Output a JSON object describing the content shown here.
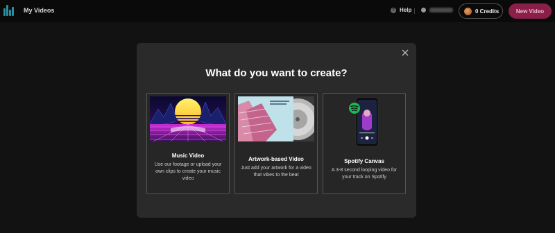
{
  "header": {
    "title": "My Videos",
    "help_label": "Help",
    "credits_label": "0 Credits",
    "new_video_label": "New Video"
  },
  "modal": {
    "title": "What do you want to create?",
    "options": [
      {
        "label": "Music Video",
        "description": "Use our footage or upload your own clips to create your music video",
        "thumb_icon": "retro-sunset-grid-image"
      },
      {
        "label": "Artwork-based Video",
        "description": "Just add your artwork for a video that vibes to the beat",
        "thumb_icon": "album-artwork-vinyl-image"
      },
      {
        "label": "Spotify Canvas",
        "description": "A 3-8 second looping video for your track on Spotify",
        "thumb_icon": "spotify-phone-image"
      }
    ]
  },
  "colors": {
    "background": "#121212",
    "modal": "#2a2a2a",
    "accent": "#8a1f4a",
    "logo": "#2a8fa0",
    "spotify_green": "#1db954"
  }
}
